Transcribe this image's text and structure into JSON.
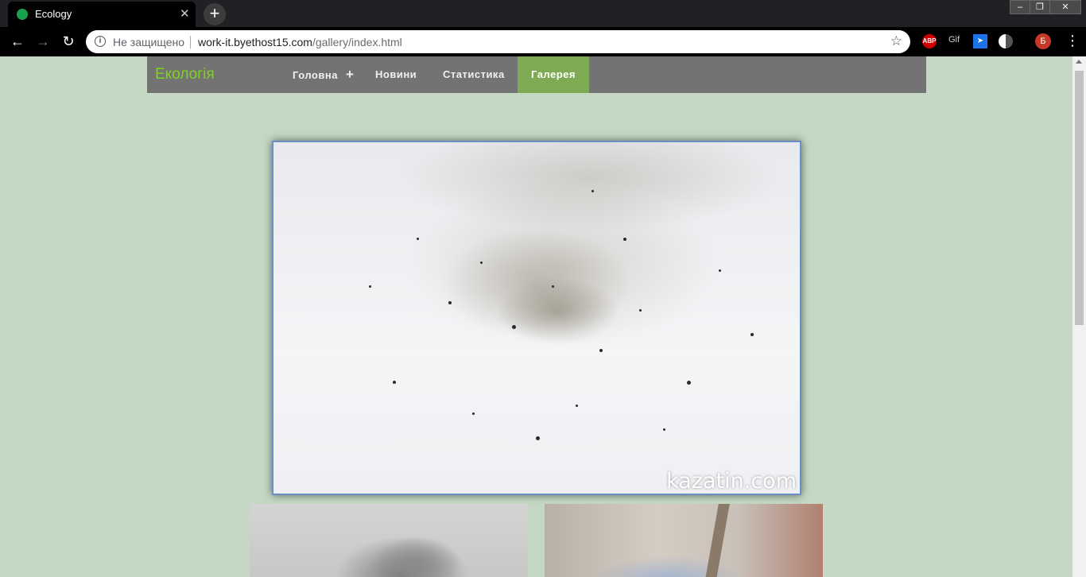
{
  "browser": {
    "tab_title": "Ecology",
    "tab_close": "✕",
    "new_tab": "+",
    "window_controls": [
      "–",
      "❐",
      "✕"
    ],
    "security_label": "Не защищено",
    "url_host": "work-it.byethost15.com",
    "url_path": "/gallery/index.html",
    "extensions": [
      "ABP",
      "Gif"
    ],
    "profile_initial": "Б"
  },
  "site": {
    "brand": "Екологія",
    "nav": [
      {
        "label": "Головна",
        "has_plus": true,
        "active": false
      },
      {
        "label": "Новини",
        "active": false
      },
      {
        "label": "Статистика",
        "active": false
      },
      {
        "label": "Галерея",
        "active": true
      }
    ],
    "nav_plus": "+",
    "accent_color": "#7daa52",
    "brand_color": "#7ed321",
    "nav_bg": "#737373",
    "page_bg": "#c4d8c4"
  },
  "gallery": {
    "main_image_watermark": "kazatin.com"
  }
}
